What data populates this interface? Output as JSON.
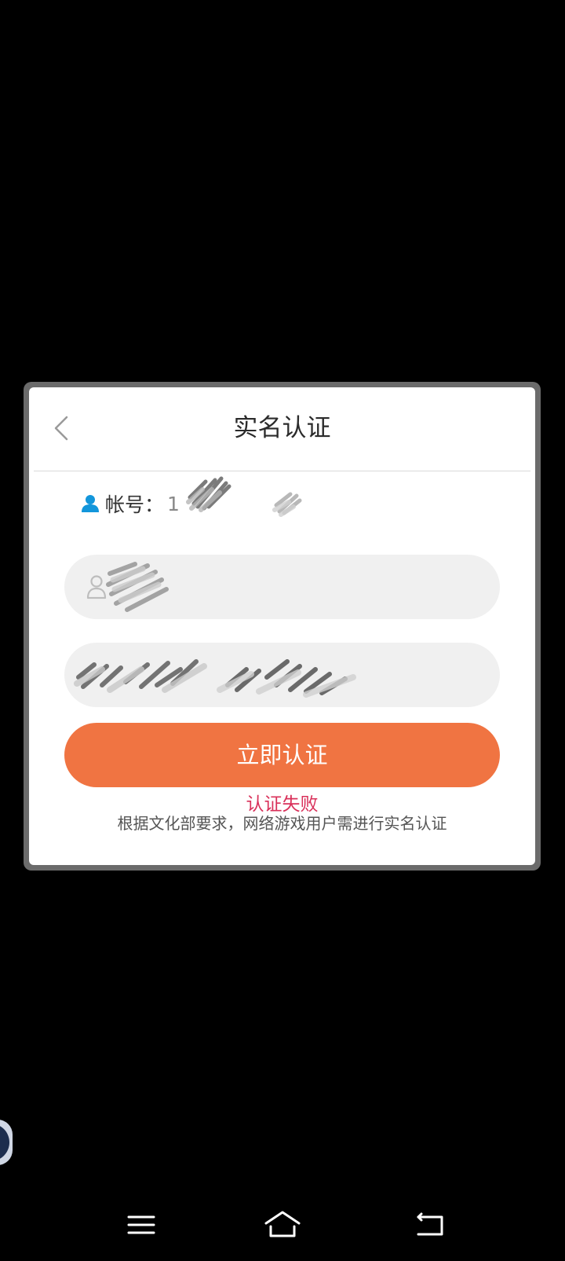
{
  "dialog": {
    "title": "实名认证",
    "account_label": "帐号：",
    "account_value_prefix": "1",
    "name_field": {
      "value": "",
      "placeholder": ""
    },
    "idcard_field": {
      "value": "",
      "placeholder": ""
    },
    "submit_label": "立即认证",
    "error_text": "认证失败",
    "notice_text": "根据文化部要求，网络游戏用户需进行实名认证"
  },
  "icons": {
    "back": "chevron-left-icon",
    "account": "user-icon",
    "name_field": "person-outline-icon",
    "floating": "floating-ball-icon",
    "nav_menu": "menu-icon",
    "nav_home": "home-icon",
    "nav_back": "back-icon"
  },
  "colors": {
    "background": "#000000",
    "dialog_border": "#6b6b6b",
    "accent": "#f07442",
    "error": "#d9305a",
    "account_icon": "#1296db",
    "input_bg": "#f0f0f0"
  }
}
